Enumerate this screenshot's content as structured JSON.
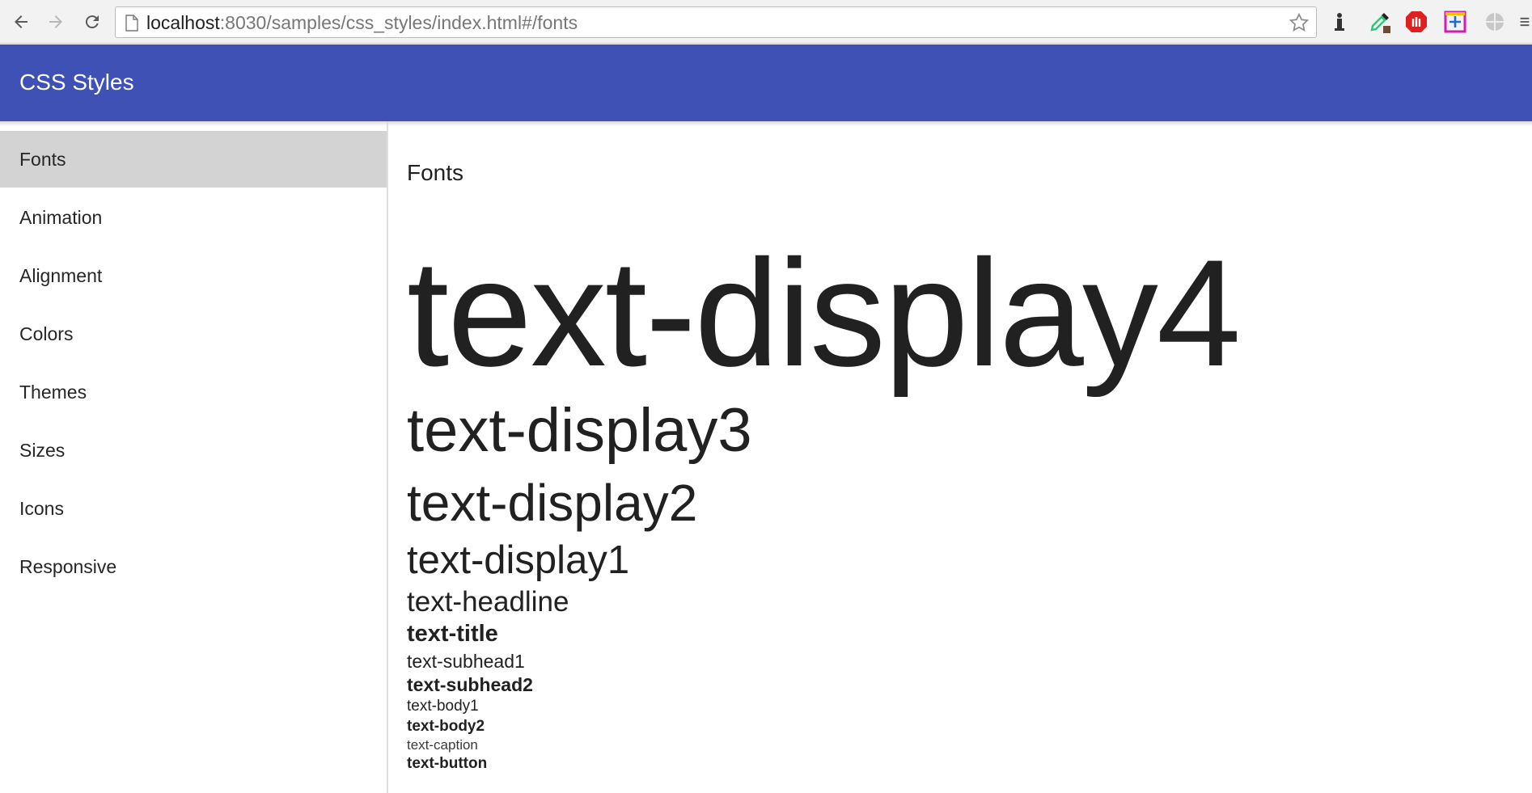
{
  "browser": {
    "url_host": "localhost",
    "url_rest": ":8030/samples/css_styles/index.html#/fonts",
    "icons": [
      "back-icon",
      "forward-icon",
      "reload-icon",
      "page-icon",
      "bookmark-star-icon",
      "extension-icons"
    ]
  },
  "app": {
    "title": "CSS Styles",
    "accent_color": "#3f51b5"
  },
  "sidebar": {
    "items": [
      {
        "label": "Fonts",
        "selected": true
      },
      {
        "label": "Animation"
      },
      {
        "label": "Alignment"
      },
      {
        "label": "Colors"
      },
      {
        "label": "Themes"
      },
      {
        "label": "Sizes"
      },
      {
        "label": "Icons"
      },
      {
        "label": "Responsive"
      }
    ]
  },
  "main": {
    "heading": "Fonts",
    "samples": {
      "display4": "text-display4",
      "display3": "text-display3",
      "display2": "text-display2",
      "display1": "text-display1",
      "headline": "text-headline",
      "title": "text-title",
      "subhead1": "text-subhead1",
      "subhead2": "text-subhead2",
      "body1": "text-body1",
      "body2": "text-body2",
      "caption": "text-caption",
      "button": "text-button"
    }
  }
}
